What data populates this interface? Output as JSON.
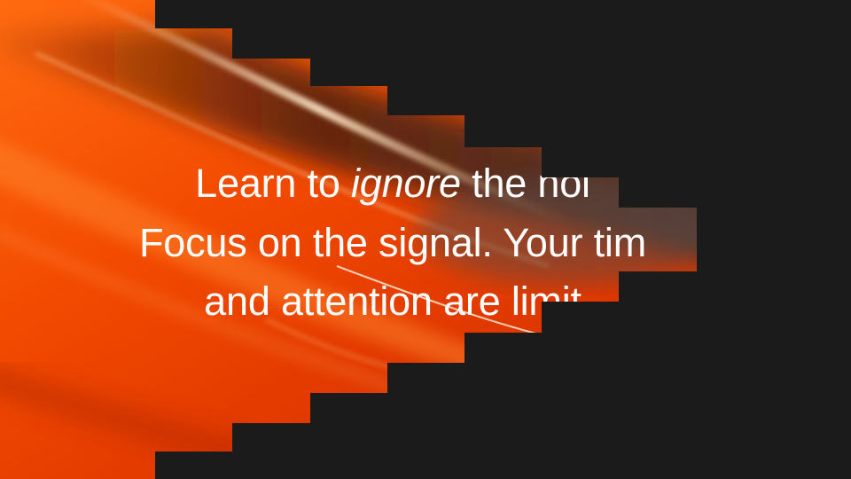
{
  "headline": {
    "line1": {
      "before": "Learn to ",
      "emphasis": "ignore",
      "after": " the noi"
    },
    "line2": "Focus on the signal. Your tim",
    "line3": "and attention are limit"
  },
  "colors": {
    "background": "#1b1b1b",
    "accent_orange": "#ff5200",
    "accent_red": "#e03000",
    "text": "#ffffff"
  }
}
